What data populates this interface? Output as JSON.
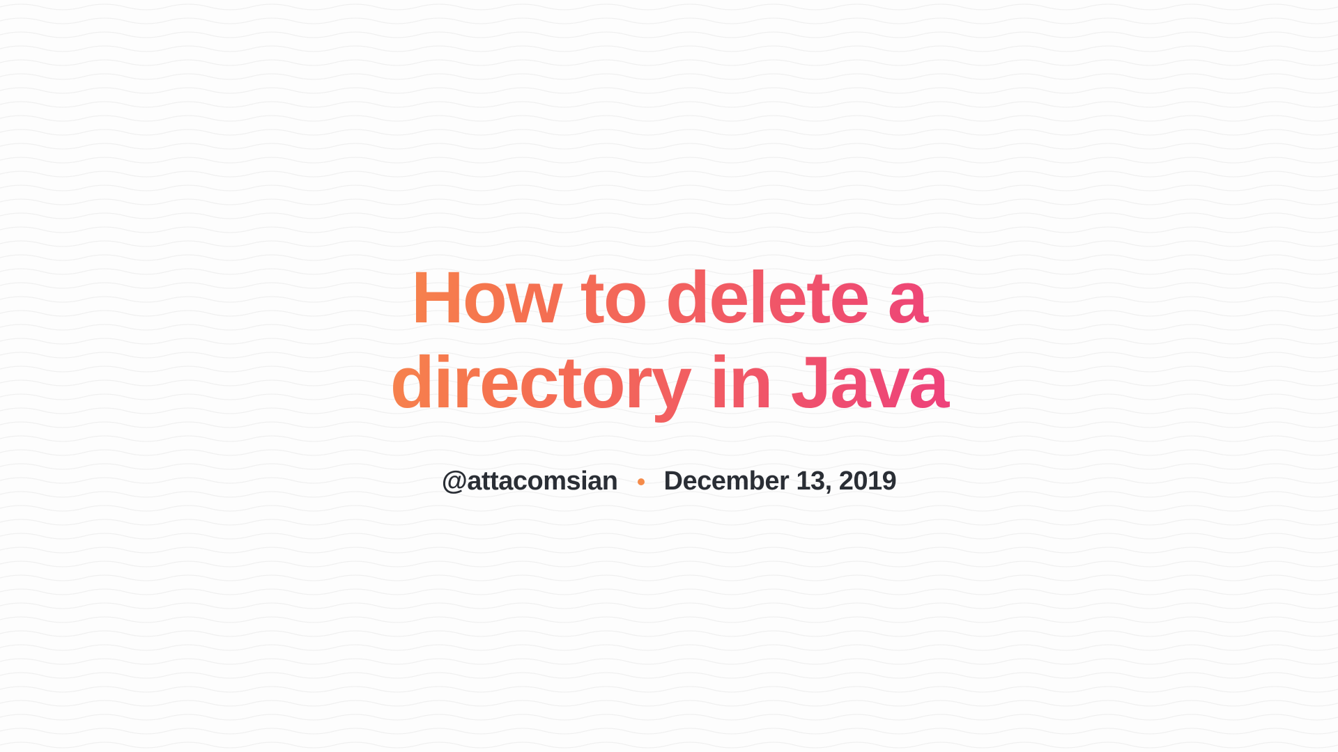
{
  "article": {
    "title": "How to delete a directory in Java",
    "author": "@attacomsian",
    "date": "December 13, 2019"
  }
}
